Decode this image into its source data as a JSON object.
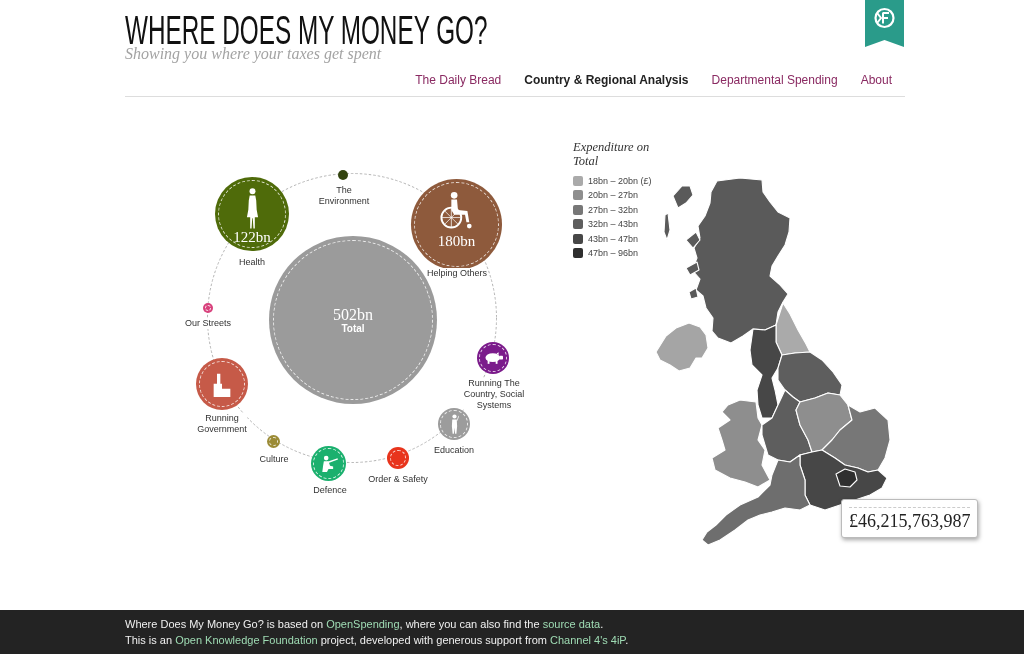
{
  "header": {
    "title": "WHERE DOES MY MONEY GO?",
    "subtitle": "Showing you where your taxes get spent"
  },
  "nav": [
    {
      "label": "The Daily Bread",
      "selected": false
    },
    {
      "label": "Country & Regional Analysis",
      "selected": true
    },
    {
      "label": "Departmental Spending",
      "selected": false
    },
    {
      "label": "About",
      "selected": false
    }
  ],
  "spending_bubbles": [
    {
      "kind": "total",
      "label": "Total",
      "amount": "502bn",
      "color": "#9b9b9b"
    },
    {
      "kind": "health",
      "label": "Health",
      "amount": "122bn",
      "color": "#4f6b0a"
    },
    {
      "kind": "environment",
      "label": "The\nEnvironment",
      "color": "#33440f"
    },
    {
      "kind": "welfare",
      "label": "Helping Others",
      "amount": "180bn",
      "color": "#8e5a3c"
    },
    {
      "kind": "streets",
      "label": "Our Streets",
      "color": "#d8417c"
    },
    {
      "kind": "social",
      "label": "Running The\nCountry, Social\nSystems",
      "color": "#7b1b8b"
    },
    {
      "kind": "government",
      "label": "Running\nGovernment",
      "color": "#c65a48"
    },
    {
      "kind": "education",
      "label": "Education",
      "color": "#9c9c9c"
    },
    {
      "kind": "culture",
      "label": "Culture",
      "color": "#9b8b36"
    },
    {
      "kind": "order",
      "label": "Order & Safety",
      "color": "#e8341c"
    },
    {
      "kind": "defence",
      "label": "Defence",
      "color": "#1bb06e"
    }
  ],
  "legend": {
    "title": "Expenditure on Total",
    "items": [
      {
        "label": "18bn – 20bn (£)",
        "color": "#aaaaaa"
      },
      {
        "label": "20bn – 27bn",
        "color": "#8e8e8e"
      },
      {
        "label": "27bn – 32bn",
        "color": "#777777"
      },
      {
        "label": "32bn – 43bn",
        "color": "#5e5e5e"
      },
      {
        "label": "43bn – 47bn",
        "color": "#474747"
      },
      {
        "label": "47bn – 96bn",
        "color": "#2f2f2f"
      }
    ]
  },
  "map_tooltip": {
    "value": "£46,215,763,987"
  },
  "footer": {
    "lines": [
      {
        "parts": [
          {
            "kind": "text",
            "text": "Where Does My Money Go? is based on "
          },
          {
            "kind": "link",
            "text": "OpenSpending"
          },
          {
            "kind": "text",
            "text": ", where you can also find the "
          },
          {
            "kind": "link",
            "text": "source data"
          },
          {
            "kind": "text",
            "text": "."
          }
        ]
      },
      {
        "parts": [
          {
            "kind": "text",
            "text": "This is an "
          },
          {
            "kind": "link",
            "text": "Open Knowledge Foundation"
          },
          {
            "kind": "text",
            "text": " project, developed with generous support from "
          },
          {
            "kind": "link",
            "text": "Channel 4's 4iP"
          },
          {
            "kind": "text",
            "text": "."
          }
        ]
      }
    ]
  }
}
